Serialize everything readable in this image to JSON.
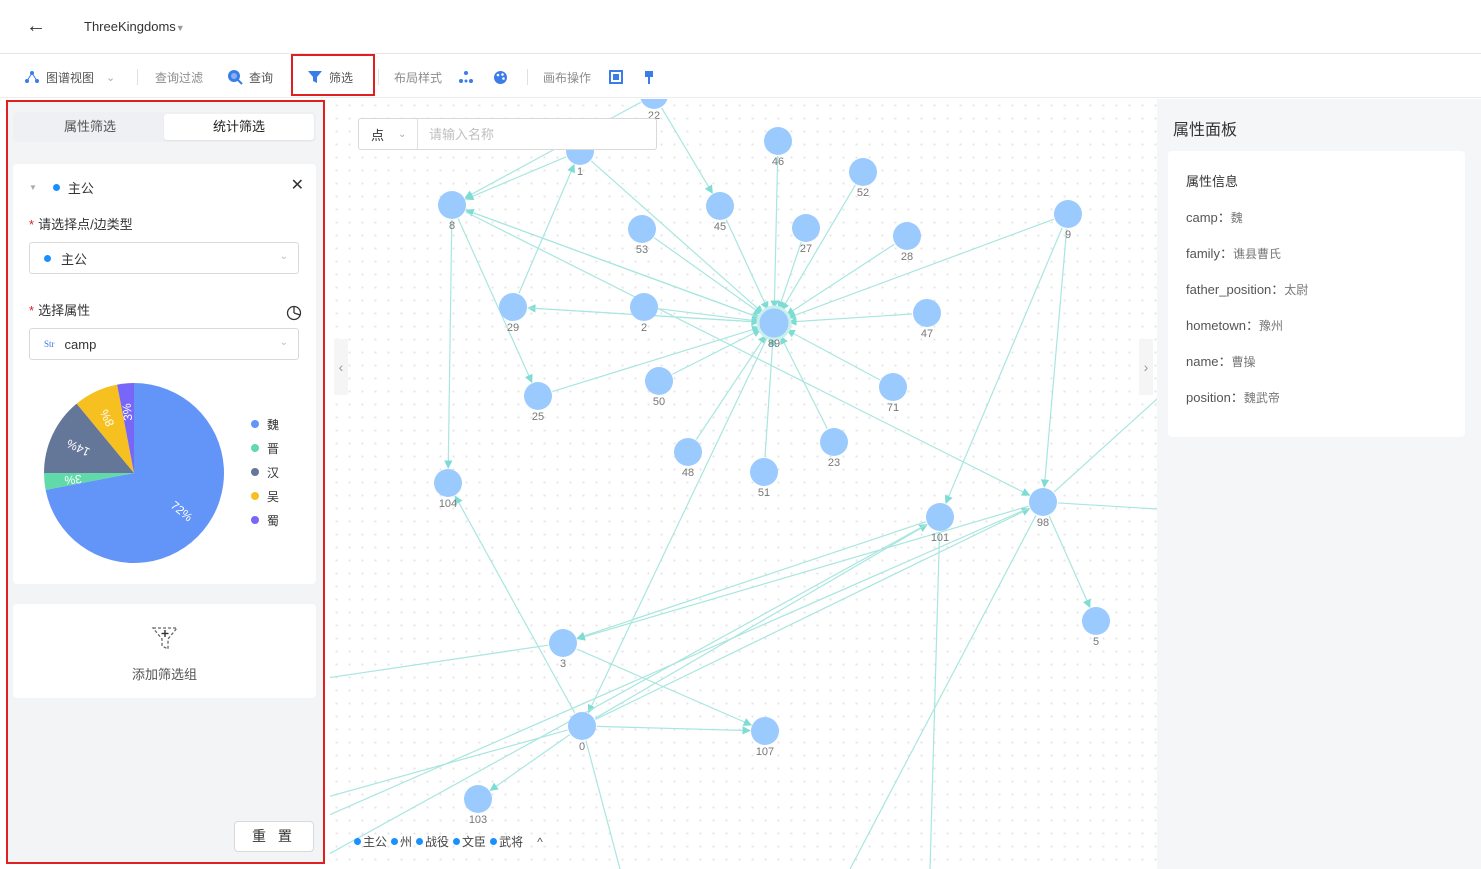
{
  "header": {
    "title": "ThreeKingdoms"
  },
  "toolbar": {
    "graph_view": "图谱视图",
    "query_filter": "查询过滤",
    "query": "查询",
    "filter": "筛选",
    "layout_style": "布局样式",
    "canvas_ops": "画布操作"
  },
  "left_panel": {
    "tab_property": "属性筛选",
    "tab_stats": "统计筛选",
    "group_name": "主公",
    "type_label": "请选择点/边类型",
    "type_value": "主公",
    "attr_label": "选择属性",
    "attr_tag": "Str",
    "attr_value": "camp",
    "add_group": "添加筛选组",
    "reset": "重 置"
  },
  "chart_data": {
    "type": "pie",
    "slices": [
      {
        "label": "魏",
        "percent": 72,
        "color": "#6394f8"
      },
      {
        "label": "晋",
        "percent": 3,
        "color": "#61d9a9"
      },
      {
        "label": "汉",
        "percent": 14,
        "color": "#657798"
      },
      {
        "label": "吴",
        "percent": 8,
        "color": "#f6c021"
      },
      {
        "label": "蜀",
        "percent": 3,
        "color": "#7766f8"
      }
    ],
    "slice_labels": [
      "72%",
      "3%",
      "14%",
      "8%",
      "3%"
    ]
  },
  "canvas": {
    "search_type": "点",
    "search_placeholder": "请输入名称",
    "legend": [
      "主公",
      "州",
      "战役",
      "文臣",
      "武将"
    ],
    "nodes": [
      "22",
      "1",
      "46",
      "52",
      "8",
      "53",
      "45",
      "27",
      "28",
      "9",
      "29",
      "2",
      "89",
      "47",
      "25",
      "50",
      "71",
      "48",
      "51",
      "23",
      "104",
      "101",
      "98",
      "5",
      "3",
      "0",
      "107",
      "103"
    ]
  },
  "right_panel": {
    "title": "属性面板",
    "card_title": "属性信息",
    "props": [
      {
        "key": "camp：",
        "value": "魏"
      },
      {
        "key": "family：",
        "value": "谯县曹氏"
      },
      {
        "key": "father_position：",
        "value": "太尉"
      },
      {
        "key": "hometown：",
        "value": "豫州"
      },
      {
        "key": "name：",
        "value": "曹操"
      },
      {
        "key": "position：",
        "value": "魏武帝"
      }
    ]
  }
}
